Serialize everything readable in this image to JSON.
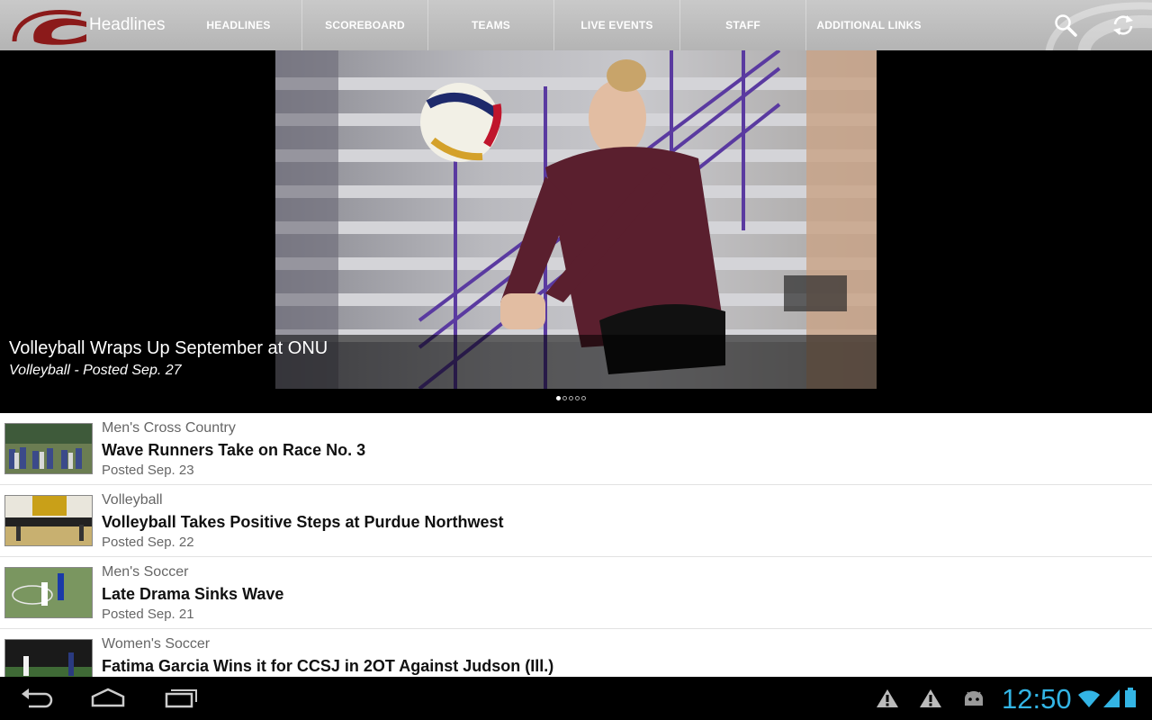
{
  "app": {
    "title": "Headlines"
  },
  "nav": {
    "tabs": [
      "HEADLINES",
      "SCOREBOARD",
      "TEAMS",
      "LIVE EVENTS",
      "STAFF",
      "ADDITIONAL LINKS"
    ]
  },
  "actions": {
    "search_icon": "search-icon",
    "refresh_icon": "refresh-icon"
  },
  "hero": {
    "title": "Volleyball Wraps Up September at ONU",
    "subtitle": "Volleyball - Posted Sep. 27",
    "page_count": 5,
    "active_page": 1
  },
  "headlines": [
    {
      "category": "Men's Cross Country",
      "title": "Wave Runners Take on Race No. 3",
      "date": "Posted Sep. 23"
    },
    {
      "category": "Volleyball",
      "title": "Volleyball Takes Positive Steps at Purdue Northwest",
      "date": "Posted Sep. 22"
    },
    {
      "category": "Men's Soccer",
      "title": "Late Drama Sinks Wave",
      "date": "Posted Sep. 21"
    },
    {
      "category": "Women's Soccer",
      "title": "Fatima Garcia Wins it for CCSJ in 2OT Against Judson (Ill.)",
      "date": ""
    }
  ],
  "system": {
    "clock": "12:50"
  },
  "colors": {
    "brand": "#8b1a1a",
    "accent": "#33b5e5"
  }
}
